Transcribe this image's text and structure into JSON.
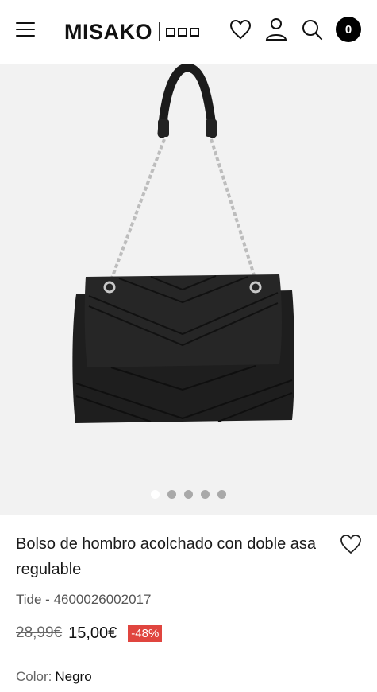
{
  "header": {
    "logo_text": "MISAKO",
    "cart_count": "0"
  },
  "gallery": {
    "slide_count": 5,
    "active_slide": 1
  },
  "product": {
    "title": "Bolso de hombro acolchado con doble asa regulable",
    "reference": "Tide - 4600026002017",
    "old_price": "28,99€",
    "price": "15,00€",
    "discount": "-48%",
    "color_label": "Color:",
    "color_value": "Negro"
  },
  "colors": {
    "discount_bg": "#e0453f",
    "gallery_bg": "#f2f2f2"
  }
}
